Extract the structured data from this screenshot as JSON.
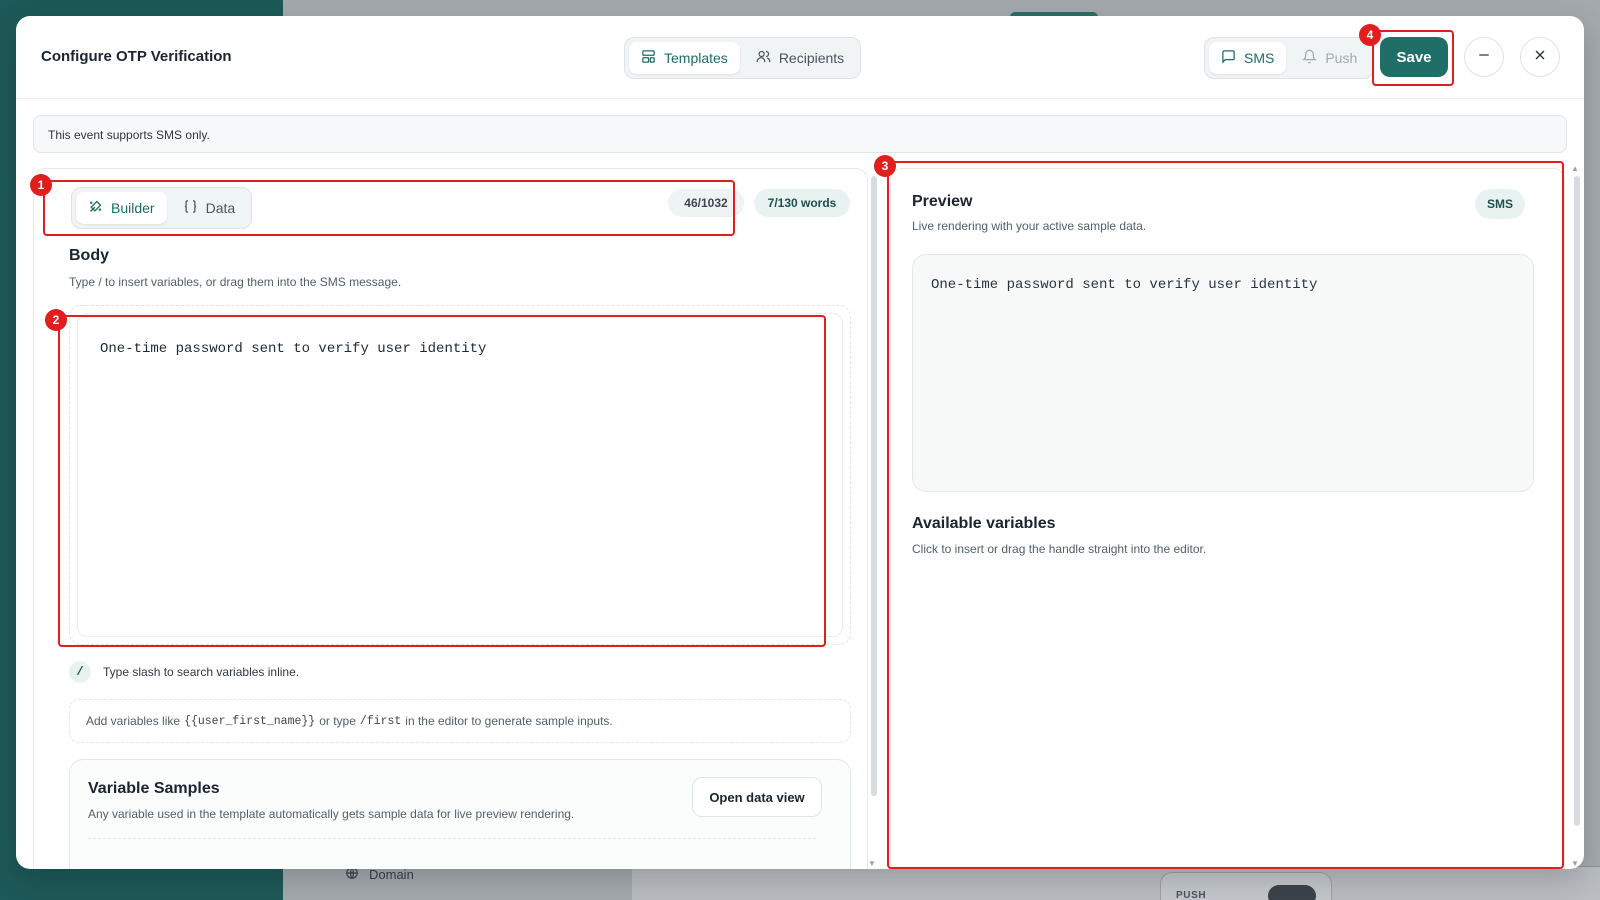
{
  "background": {
    "domain_label": "Domain",
    "push_label": "PUSH"
  },
  "modal": {
    "title": "Configure OTP Verification",
    "main_tabs": [
      {
        "label": "Templates",
        "icon": "layout-template-icon",
        "active": true
      },
      {
        "label": "Recipients",
        "icon": "users-icon",
        "active": false
      }
    ],
    "channel_tabs": [
      {
        "label": "SMS",
        "icon": "message-square-icon",
        "active": true
      },
      {
        "label": "Push",
        "icon": "bell-icon",
        "active": false
      }
    ],
    "save_label": "Save",
    "minimize_icon": "minus-icon",
    "close_icon": "close-icon"
  },
  "info_bar": {
    "text": "This event supports SMS only."
  },
  "editor_panel": {
    "mode_tabs": [
      {
        "label": "Builder",
        "icon": "builder-icon",
        "active": true
      },
      {
        "label": "Data",
        "icon": "braces-icon",
        "active": false
      }
    ],
    "char_count": "46/1032",
    "word_count": "7/130 words",
    "body_title": "Body",
    "body_subtitle": "Type / to insert variables, or drag them into the SMS message.",
    "body_text": "One-time password sent to verify user identity",
    "slash_symbol": "/",
    "slash_hint": "Type slash to search variables inline.",
    "add_vars": {
      "prefix": "Add variables like",
      "example_var": "{{user_first_name}}",
      "middle": "or type",
      "example_cmd": "/first",
      "suffix": "in the editor to generate sample inputs."
    },
    "samples": {
      "title": "Variable Samples",
      "subtitle": "Any variable used in the template automatically gets sample data for live preview rendering.",
      "open_data_label": "Open data view"
    }
  },
  "preview_panel": {
    "title": "Preview",
    "subtitle": "Live rendering with your active sample data.",
    "channel_badge": "SMS",
    "preview_text": "One-time password sent to verify user identity",
    "available_title": "Available variables",
    "available_subtitle": "Click to insert or drag the handle straight into the editor."
  },
  "annotations": [
    {
      "number": "1",
      "target": "editor-mode-tabs-and-counter"
    },
    {
      "number": "2",
      "target": "body-editor"
    },
    {
      "number": "3",
      "target": "preview-panel"
    },
    {
      "number": "4",
      "target": "save-button"
    }
  ],
  "colors": {
    "accent": "#1f6e68",
    "annotation": "#e11d1d",
    "sidebar_bg": "#1d5958"
  }
}
